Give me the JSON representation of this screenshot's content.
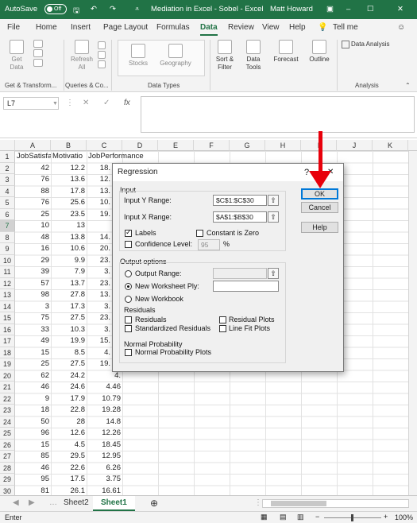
{
  "titlebar": {
    "autosave_label": "AutoSave",
    "autosave_state": "Off",
    "doc_title": "Mediation in Excel - Sobel  -  Excel",
    "user": "Matt Howard",
    "bg_color": "#217346"
  },
  "menu": {
    "items": [
      "File",
      "Home",
      "Insert",
      "Page Layout",
      "Formulas",
      "Data",
      "Review",
      "View",
      "Help"
    ],
    "active": "Data",
    "tell_me": "Tell me"
  },
  "ribbon": {
    "get_data": [
      "Get",
      "Data"
    ],
    "refresh": [
      "Refresh",
      "All"
    ],
    "stocks": "Stocks",
    "geography": "Geography",
    "sort_filter": [
      "Sort &",
      "Filter"
    ],
    "data_tools": [
      "Data",
      "Tools"
    ],
    "forecast": "Forecast",
    "outline": "Outline",
    "data_analysis": "Data Analysis",
    "groups": [
      "Get & Transform...",
      "Queries & Co...",
      "Data Types",
      "Analysis"
    ]
  },
  "formula_bar": {
    "name_box": "L7",
    "fx": "fx",
    "content": ""
  },
  "sheet": {
    "columns": [
      "A",
      "B",
      "C",
      "D",
      "E",
      "F",
      "G",
      "H",
      "I",
      "J",
      "K"
    ],
    "row_numbers": [
      "1",
      "2",
      "3",
      "4",
      "5",
      "6",
      "7",
      "8",
      "9",
      "10",
      "11",
      "12",
      "13",
      "14",
      "15",
      "16",
      "17",
      "18",
      "19",
      "20",
      "21",
      "22",
      "23",
      "24",
      "25",
      "26",
      "27",
      "28",
      "29",
      "30",
      "31"
    ],
    "selected_row": "7",
    "headers": [
      "JobSatisfa",
      "Motivatio",
      "JobPerformance"
    ],
    "col_a": [
      "42",
      "76",
      "88",
      "76",
      "25",
      "10",
      "48",
      "16",
      "29",
      "39",
      "57",
      "98",
      "3",
      "75",
      "33",
      "49",
      "15",
      "25",
      "62",
      "46",
      "9",
      "18",
      "50",
      "96",
      "15",
      "85",
      "46",
      "95",
      "81"
    ],
    "col_b": [
      "12.2",
      "13.6",
      "17.8",
      "25.6",
      "23.5",
      "13",
      "13.8",
      "10.6",
      "9.9",
      "7.9",
      "13.7",
      "27.8",
      "17.3",
      "27.5",
      "10.3",
      "19.9",
      "8.5",
      "27.5",
      "24.2",
      "24.6",
      "17.9",
      "22.8",
      "28",
      "12.6",
      "4.5",
      "29.5",
      "22.6",
      "17.5",
      "26.1"
    ],
    "col_c_visible": [
      "18.",
      "12.",
      "13.",
      "10.",
      "19.",
      "",
      "14.",
      "20.",
      "23.",
      "3.",
      "23.",
      "13.",
      "3.",
      "23.",
      "3.",
      "15.",
      "4.",
      "19.",
      "4.",
      "4.46",
      "10.79",
      "19.28",
      "14.8",
      "12.26",
      "18.45",
      "12.95",
      "6.26",
      "3.75",
      "16.61"
    ]
  },
  "sheet_tabs": [
    "Sheet2",
    "Sheet1"
  ],
  "active_tab": "Sheet1",
  "status": {
    "mode": "Enter",
    "zoom": "100%"
  },
  "dialog": {
    "title": "Regression",
    "help_glyph": "?",
    "close_glyph": "✕",
    "input_section": "Input",
    "input_y_label": "Input Y Range:",
    "input_y_value": "$C$1:$C$30",
    "input_x_label": "Input X Range:",
    "input_x_value": "$A$1:$B$30",
    "labels": "Labels",
    "labels_checked": true,
    "constant_zero": "Constant is Zero",
    "confidence_label": "Confidence Level:",
    "confidence_value": "95",
    "percent": "%",
    "output_section": "Output options",
    "output_range": "Output Range:",
    "new_ws_ply": "New Worksheet Ply:",
    "new_workbook": "New Workbook",
    "residuals_section": "Residuals",
    "residuals": "Residuals",
    "std_residuals": "Standardized Residuals",
    "residual_plots": "Residual Plots",
    "line_fit": "Line Fit Plots",
    "normal_prob_section": "Normal Probability",
    "normal_prob_plots": "Normal Probability Plots",
    "ok": "OK",
    "cancel": "Cancel",
    "help": "Help",
    "ref_glyph": "⇧"
  },
  "annotation": {
    "arrow_color": "#e8000b"
  }
}
